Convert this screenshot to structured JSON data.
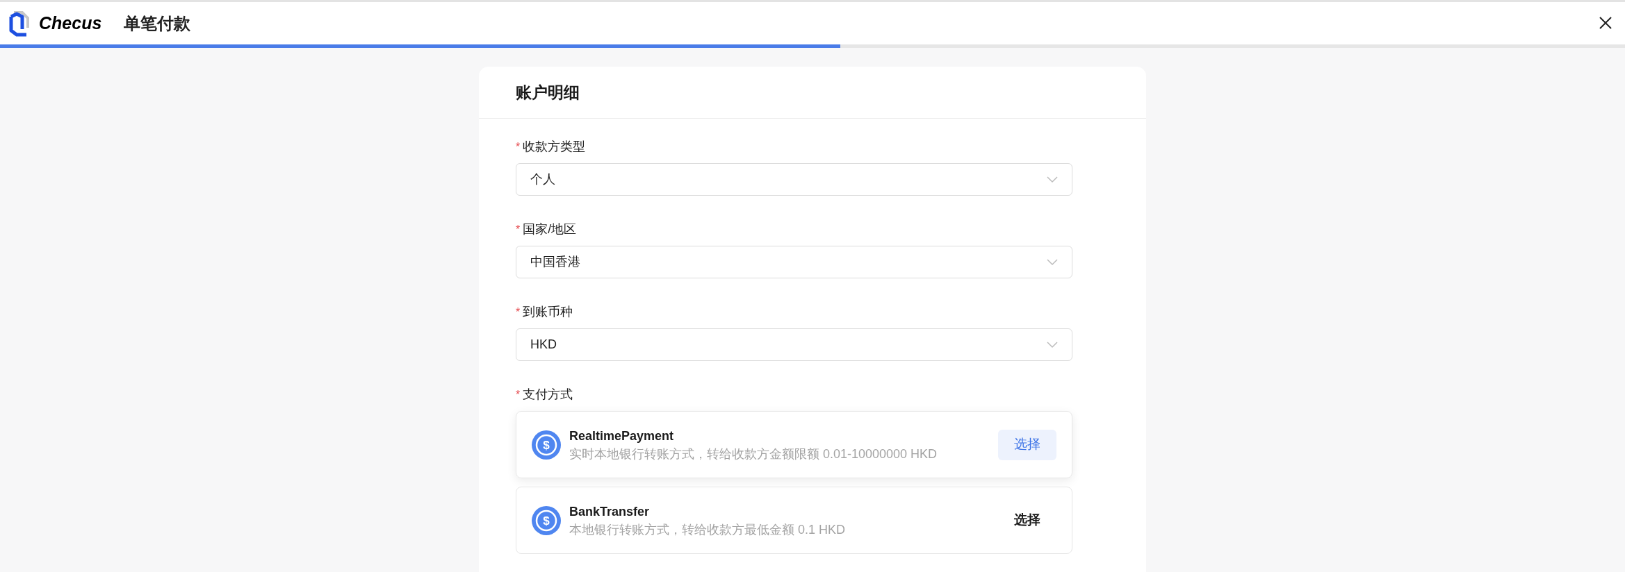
{
  "header": {
    "logo_text": "Checus",
    "title": "单笔付款"
  },
  "progress": {
    "level": 0.517
  },
  "card": {
    "title": "账户明细",
    "fields": [
      {
        "label": "收款方类型",
        "required_mark": "*",
        "value": "个人"
      },
      {
        "label": "国家/地区",
        "required_mark": "*",
        "value": "中国香港"
      },
      {
        "label": "到账币种",
        "required_mark": "*",
        "value": "HKD"
      }
    ],
    "payment_methods": {
      "label": "支付方式",
      "required_mark": "*",
      "options": [
        {
          "icon_symbol": "$",
          "name": "RealtimePayment",
          "description": "实时本地银行转账方式，转给收款方金额限额 0.01-10000000 HKD",
          "button": "选择",
          "highlighted": true
        },
        {
          "icon_symbol": "$",
          "name": "BankTransfer",
          "description": "本地银行转账方式，转给收款方最低金额 0.1 HKD",
          "button": "选择",
          "highlighted": false
        }
      ]
    }
  }
}
